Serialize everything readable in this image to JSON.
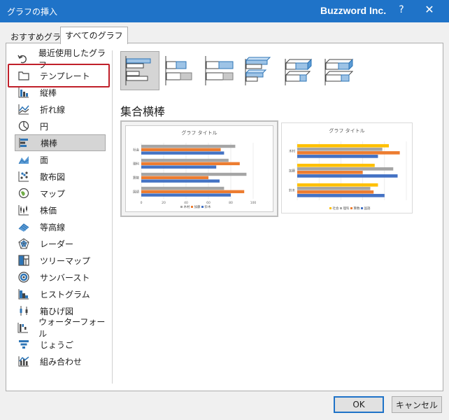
{
  "window": {
    "title": "グラフの挿入",
    "brand": "Buzzword Inc.",
    "help": "?",
    "close": "✕"
  },
  "tabs": [
    {
      "label": "おすすめグラフ",
      "active": false
    },
    {
      "label": "すべてのグラフ",
      "active": true
    }
  ],
  "sidebar": {
    "items": [
      {
        "label": "最近使用したグラフ",
        "icon": "undo-icon"
      },
      {
        "label": "テンプレート",
        "icon": "folder-icon"
      },
      {
        "label": "縦棒",
        "icon": "column-chart-icon"
      },
      {
        "label": "折れ線",
        "icon": "line-chart-icon"
      },
      {
        "label": "円",
        "icon": "pie-chart-icon"
      },
      {
        "label": "横棒",
        "icon": "bar-chart-icon",
        "selected": true
      },
      {
        "label": "面",
        "icon": "area-chart-icon"
      },
      {
        "label": "散布図",
        "icon": "scatter-chart-icon"
      },
      {
        "label": "マップ",
        "icon": "map-chart-icon"
      },
      {
        "label": "株価",
        "icon": "stock-chart-icon"
      },
      {
        "label": "等高線",
        "icon": "surface-chart-icon"
      },
      {
        "label": "レーダー",
        "icon": "radar-chart-icon"
      },
      {
        "label": "ツリーマップ",
        "icon": "treemap-icon"
      },
      {
        "label": "サンバースト",
        "icon": "sunburst-icon"
      },
      {
        "label": "ヒストグラム",
        "icon": "histogram-icon"
      },
      {
        "label": "箱ひげ図",
        "icon": "box-whisker-icon"
      },
      {
        "label": "ウォーターフォール",
        "icon": "waterfall-icon"
      },
      {
        "label": "じょうご",
        "icon": "funnel-icon"
      },
      {
        "label": "組み合わせ",
        "icon": "combo-chart-icon"
      }
    ]
  },
  "main": {
    "section_title": "集合横棒",
    "subtypes": [
      {
        "name": "clustered-bar",
        "selected": true
      },
      {
        "name": "stacked-bar"
      },
      {
        "name": "100-percent-stacked-bar"
      },
      {
        "name": "3d-clustered-bar"
      },
      {
        "name": "3d-stacked-bar"
      },
      {
        "name": "3d-100-percent-stacked-bar"
      }
    ]
  },
  "chart_data": [
    {
      "type": "bar",
      "title": "グラフ タイトル",
      "categories": [
        "社会",
        "理科",
        "算数",
        "国語"
      ],
      "series": [
        {
          "name": "木村",
          "color": "#a5a5a5",
          "values": [
            84,
            78,
            94,
            74
          ]
        },
        {
          "name": "加藤",
          "color": "#ed7d31",
          "values": [
            71,
            88,
            60,
            92
          ]
        },
        {
          "name": "鈴木",
          "color": "#4472c4",
          "values": [
            74,
            67,
            70,
            80
          ]
        }
      ],
      "xlim": [
        0,
        100
      ],
      "xticks": [
        "0",
        "20",
        "40",
        "60",
        "80",
        "100"
      ]
    },
    {
      "type": "bar",
      "title": "グラフ タイトル",
      "categories": [
        "木村",
        "加藤",
        "鈴木"
      ],
      "series": [
        {
          "name": "社会",
          "color": "#ffc000",
          "values": [
            84,
            71,
            74
          ]
        },
        {
          "name": "理科",
          "color": "#a5a5a5",
          "values": [
            78,
            88,
            67
          ]
        },
        {
          "name": "算数",
          "color": "#ed7d31",
          "values": [
            94,
            60,
            70
          ]
        },
        {
          "name": "国語",
          "color": "#4472c4",
          "values": [
            74,
            92,
            80
          ]
        }
      ],
      "xlim": [
        0,
        100
      ]
    }
  ],
  "buttons": {
    "ok": "OK",
    "cancel": "キャンセル"
  },
  "colors": {
    "titlebar": "#1f73c8",
    "highlight": "#c0202a",
    "icon_blue": "#2e75b6"
  }
}
